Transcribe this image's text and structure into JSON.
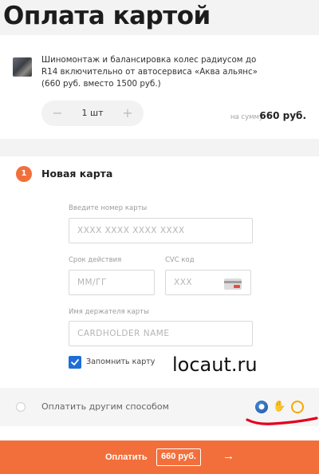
{
  "header": {
    "title": "Оплата картой"
  },
  "order": {
    "description": "Шиномонтаж и балансировка колес радиусом до R14 включительно от автосервиса «Аква альянс» (660 руб. вместо 1500 руб.)",
    "quantity": "1 шт",
    "minus_icon": "minus-icon",
    "plus_icon": "plus-icon",
    "sum_label": "на сумму",
    "sum_value": "660 руб."
  },
  "new_card": {
    "step": "1",
    "title": "Новая карта",
    "card_number_label": "Введите номер карты",
    "card_number_placeholder": "XXXX XXXX XXXX XXXX",
    "expiry_label": "Срок действия",
    "expiry_placeholder": "ММ/ГГ",
    "cvc_label": "CVC код",
    "cvc_placeholder": "XXX",
    "holder_label": "Имя держателя карты",
    "holder_placeholder": "CARDHOLDER NAME",
    "remember_label": "Запомнить карту",
    "remember_checked": true
  },
  "watermark": "locaut.ru",
  "other_method": {
    "label": "Оплатить другим способом",
    "icons": [
      "webmoney-icon",
      "yandex-money-icon",
      "qiwi-icon"
    ]
  },
  "pay": {
    "label": "Оплатить",
    "amount": "660 руб.",
    "arrow_icon": "arrow-right-icon"
  },
  "colors": {
    "accent": "#f26f3b",
    "checkbox": "#1e6ed6",
    "annotation_red": "#e3001b"
  }
}
